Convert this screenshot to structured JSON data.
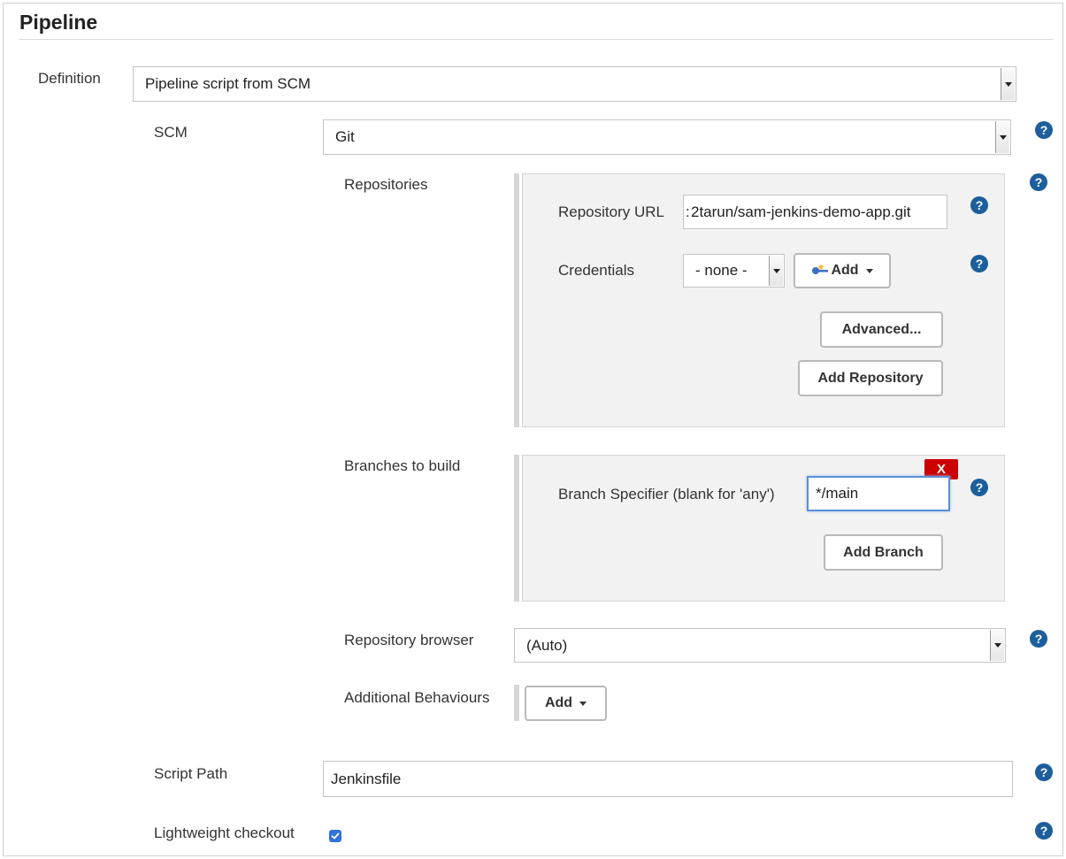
{
  "section": {
    "title": "Pipeline"
  },
  "definition": {
    "label": "Definition",
    "value": "Pipeline script from SCM"
  },
  "scm": {
    "label": "SCM",
    "value": "Git"
  },
  "repositories": {
    "label": "Repositories",
    "url_label": "Repository URL",
    "url_value": "2tarun/sam-jenkins-demo-app.git",
    "url_prefix": ":",
    "credentials_label": "Credentials",
    "credentials_value": "- none -",
    "add_label": "Add",
    "advanced_label": "Advanced...",
    "add_repository_label": "Add Repository"
  },
  "branches": {
    "label": "Branches to build",
    "specifier_label": "Branch Specifier (blank for 'any')",
    "specifier_value": "*/main",
    "delete_label": "X",
    "add_branch_label": "Add Branch"
  },
  "repo_browser": {
    "label": "Repository browser",
    "value": "(Auto)"
  },
  "additional_behaviours": {
    "label": "Additional Behaviours",
    "add_label": "Add"
  },
  "script_path": {
    "label": "Script Path",
    "value": "Jenkinsfile"
  },
  "lightweight_checkout": {
    "label": "Lightweight checkout",
    "checked": true
  },
  "help_symbol": "?",
  "colors": {
    "help": "#1d5e9c",
    "delete": "#cc0000",
    "focus": "#5b8fd8",
    "checkbox": "#2f72d8"
  },
  "icons": {
    "help": "help-icon",
    "key": "key-icon",
    "dropdown": "chevron-down-icon",
    "check": "check-icon"
  }
}
